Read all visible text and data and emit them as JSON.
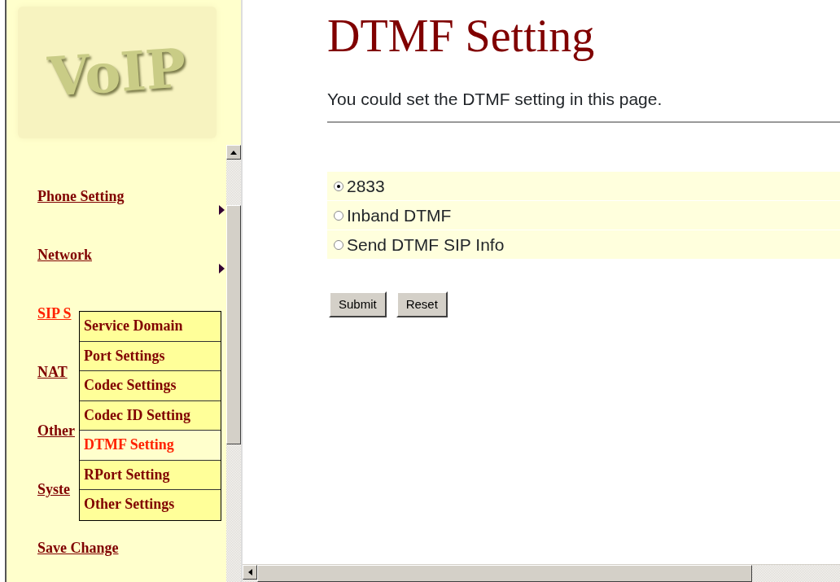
{
  "sidebar": {
    "logo": "VoIP",
    "items": [
      {
        "label": "Phone Setting",
        "selected": false,
        "arrow": true
      },
      {
        "label": "Network",
        "selected": false,
        "arrow": true
      },
      {
        "label": "SIP S",
        "selected": true,
        "arrow": false
      },
      {
        "label": "NAT",
        "selected": false,
        "arrow": false
      },
      {
        "label": "Other",
        "selected": false,
        "arrow": false
      },
      {
        "label": "Syste",
        "selected": false,
        "arrow": false
      },
      {
        "label": "Save Change",
        "selected": false,
        "arrow": false
      }
    ],
    "submenu": [
      {
        "label": "Service Domain",
        "selected": false
      },
      {
        "label": "Port Settings",
        "selected": false
      },
      {
        "label": "Codec Settings",
        "selected": false
      },
      {
        "label": "Codec ID Setting",
        "selected": false
      },
      {
        "label": "DTMF Setting",
        "selected": true
      },
      {
        "label": "RPort Setting",
        "selected": false
      },
      {
        "label": "Other Settings",
        "selected": false
      }
    ]
  },
  "main": {
    "title": "DTMF Setting",
    "intro": "You could set the DTMF setting in this page.",
    "options": [
      {
        "label": "2833",
        "selected": true
      },
      {
        "label": "Inband DTMF",
        "selected": false
      },
      {
        "label": "Send DTMF SIP Info",
        "selected": false
      }
    ],
    "buttons": [
      "Submit",
      "Reset"
    ]
  }
}
